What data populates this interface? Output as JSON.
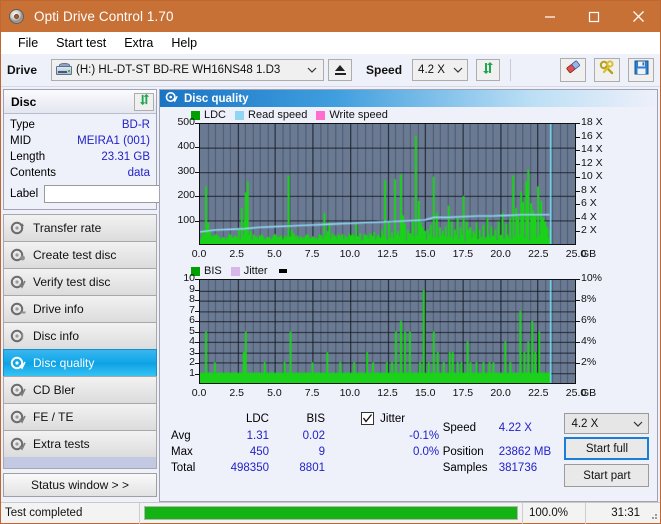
{
  "window": {
    "title": "Opti Drive Control 1.70",
    "title_icon": "disc-icon",
    "minimize": "–",
    "maximize": "□",
    "close": "✕"
  },
  "menu": {
    "items": [
      "File",
      "Start test",
      "Extra",
      "Help"
    ]
  },
  "toolbar": {
    "drive_label": "Drive",
    "drive_value": "(H:)   HL-DT-ST BD-RE  WH16NS48 1.D3",
    "eject_icon": "eject-icon",
    "speed_label": "Speed",
    "speed_value": "4.2 X",
    "refresh_icon": "refresh-icon",
    "eraser_icon": "eraser-icon",
    "tools_icon": "tools-icon",
    "save_icon": "save-icon"
  },
  "disc": {
    "header": "Disc",
    "refresh_icon": "refresh-disc-icon",
    "rows": [
      {
        "key": "Type",
        "value": "BD-R"
      },
      {
        "key": "MID",
        "value": "MEIRA1 (001)"
      },
      {
        "key": "Length",
        "value": "23.31 GB"
      },
      {
        "key": "Contents",
        "value": "data"
      }
    ],
    "label_key": "Label",
    "label_value": "",
    "label_placeholder": "",
    "label_button_icon": "disc-icon"
  },
  "nav": {
    "items": [
      {
        "label": "Transfer rate",
        "icon": "disc-test-icon",
        "selected": false
      },
      {
        "label": "Create test disc",
        "icon": "disc-burn-icon",
        "selected": false
      },
      {
        "label": "Verify test disc",
        "icon": "disc-verify-icon",
        "selected": false
      },
      {
        "label": "Drive info",
        "icon": "drive-info-icon",
        "selected": false
      },
      {
        "label": "Disc info",
        "icon": "disc-info-icon",
        "selected": false
      },
      {
        "label": "Disc quality",
        "icon": "disc-quality-icon",
        "selected": true
      },
      {
        "label": "CD Bler",
        "icon": "cd-bler-icon",
        "selected": false
      },
      {
        "label": "FE / TE",
        "icon": "fe-te-icon",
        "selected": false
      },
      {
        "label": "Extra tests",
        "icon": "extra-tests-icon",
        "selected": false
      }
    ],
    "status_window": "Status window > >"
  },
  "panel": {
    "title": "Disc quality",
    "icon": "disc-quality-icon"
  },
  "chart_data": [
    {
      "type": "line",
      "id": "ldc-chart",
      "title": "",
      "legend": [
        {
          "label": "LDC",
          "color": "#00a000"
        },
        {
          "label": "Read speed",
          "color": "#8fd6f5"
        },
        {
          "label": "Write speed",
          "color": "#ff6ecd"
        }
      ],
      "legend_position": "top-left",
      "xlabel": "GB",
      "x_ticks": [
        "0.0",
        "2.5",
        "5.0",
        "7.5",
        "10.0",
        "12.5",
        "15.0",
        "17.5",
        "20.0",
        "22.5",
        "25.0"
      ],
      "xlim": [
        0,
        25
      ],
      "ylabel": "LDC",
      "y_ticks": [
        "100",
        "200",
        "300",
        "400",
        "500"
      ],
      "ylim": [
        0,
        500
      ],
      "y2label": "Speed",
      "y2_ticks": [
        "2 X",
        "4 X",
        "6 X",
        "8 X",
        "10 X",
        "12 X",
        "14 X",
        "16 X",
        "18 X"
      ],
      "y2lim": [
        0,
        18
      ],
      "grid": true,
      "series": [
        {
          "name": "LDC",
          "color": "#19d219",
          "type": "bar",
          "x": [
            0.15,
            0.3,
            0.45,
            0.6,
            0.8,
            1.0,
            1.2,
            1.45,
            1.7,
            1.9,
            2.1,
            2.3,
            2.5,
            2.7,
            2.9,
            3.0,
            3.1,
            3.3,
            3.5,
            3.7,
            3.9,
            4.1,
            4.35,
            4.6,
            4.8,
            5.0,
            5.2,
            5.4,
            5.6,
            5.85,
            6.05,
            6.2,
            6.4,
            6.6,
            6.85,
            7.1,
            7.3,
            7.5,
            7.7,
            7.95,
            8.2,
            8.4,
            8.55,
            8.75,
            8.95,
            9.15,
            9.4,
            9.6,
            9.85,
            10.1,
            10.35,
            10.6,
            10.85,
            11.05,
            11.3,
            11.55,
            11.8,
            12.05,
            12.3,
            12.5,
            12.7,
            12.9,
            13.1,
            13.3,
            13.45,
            13.6,
            13.8,
            13.95,
            14.1,
            14.3,
            14.5,
            14.65,
            14.8,
            14.95,
            15.15,
            15.35,
            15.5,
            15.7,
            15.9,
            16.1,
            16.3,
            16.5,
            16.7,
            16.9,
            17.1,
            17.3,
            17.5,
            17.7,
            17.85,
            18.0,
            18.2,
            18.4,
            18.6,
            18.85,
            19.1,
            19.35,
            19.6,
            19.85,
            20.1,
            20.35,
            20.6,
            20.85,
            21.0,
            21.15,
            21.35,
            21.5,
            21.7,
            21.85,
            22.0,
            22.15,
            22.3,
            22.5,
            22.65,
            22.8,
            22.95,
            23.1,
            23.25
          ],
          "values": [
            60,
            240,
            90,
            55,
            35,
            25,
            30,
            20,
            25,
            20,
            25,
            30,
            60,
            150,
            100,
            215,
            260,
            55,
            40,
            30,
            35,
            30,
            25,
            30,
            25,
            40,
            30,
            25,
            35,
            285,
            60,
            45,
            35,
            30,
            25,
            30,
            25,
            30,
            25,
            35,
            130,
            55,
            90,
            45,
            35,
            30,
            40,
            35,
            45,
            40,
            85,
            45,
            40,
            35,
            45,
            50,
            40,
            60,
            265,
            95,
            50,
            270,
            55,
            290,
            120,
            85,
            60,
            45,
            95,
            450,
            180,
            90,
            70,
            55,
            60,
            80,
            280,
            130,
            70,
            55,
            75,
            160,
            95,
            60,
            110,
            70,
            200,
            95,
            60,
            70,
            55,
            90,
            60,
            80,
            110,
            75,
            60,
            95,
            130,
            85,
            110,
            285,
            150,
            115,
            220,
            175,
            260,
            310,
            170,
            140,
            120,
            240,
            180,
            110,
            95,
            70,
            60
          ]
        },
        {
          "name": "Read speed",
          "color": "#8fd6f5",
          "type": "line",
          "x": [
            0.0,
            1.0,
            2.0,
            3.0,
            4.0,
            5.0,
            6.0,
            7.0,
            8.0,
            9.0,
            10.0,
            11.0,
            12.0,
            13.0,
            14.0,
            15.0,
            15.6,
            16.5,
            17.5,
            18.5,
            19.5,
            20.5,
            21.5,
            22.5,
            23.3
          ],
          "values": [
            1.8,
            2.1,
            2.2,
            2.3,
            2.5,
            2.6,
            2.7,
            2.8,
            2.9,
            3.0,
            3.1,
            3.2,
            3.3,
            3.4,
            3.5,
            3.6,
            4.0,
            4.0,
            4.1,
            4.2,
            4.2,
            4.3,
            4.4,
            4.4,
            4.4
          ]
        }
      ],
      "cursor_x": 23.35,
      "cursor_color": "#6fe3ff"
    },
    {
      "type": "bar",
      "id": "bis-chart",
      "title": "",
      "legend": [
        {
          "label": "BIS",
          "color": "#00a000"
        },
        {
          "label": "Jitter",
          "color": "#d8b6e8"
        }
      ],
      "legend_position": "top-left",
      "xlabel": "GB",
      "x_ticks": [
        "0.0",
        "2.5",
        "5.0",
        "7.5",
        "10.0",
        "12.5",
        "15.0",
        "17.5",
        "20.0",
        "22.5",
        "25.0"
      ],
      "xlim": [
        0,
        25
      ],
      "ylabel": "BIS",
      "y_ticks": [
        "1",
        "2",
        "3",
        "4",
        "5",
        "6",
        "7",
        "8",
        "9",
        "10"
      ],
      "ylim": [
        0,
        10
      ],
      "y2label": "Jitter",
      "y2_ticks": [
        "2%",
        "4%",
        "6%",
        "8%",
        "10%"
      ],
      "y2lim": [
        0,
        10
      ],
      "grid": true,
      "series": [
        {
          "name": "BIS",
          "color": "#19d219",
          "type": "bar",
          "x": [
            0.3,
            0.55,
            0.9,
            1.3,
            1.8,
            2.3,
            2.85,
            3.0,
            3.5,
            3.9,
            4.25,
            4.7,
            5.2,
            5.6,
            6.0,
            6.5,
            7.0,
            7.4,
            7.9,
            8.4,
            8.8,
            9.3,
            9.7,
            10.2,
            10.6,
            11.1,
            11.5,
            11.9,
            12.4,
            12.7,
            13.0,
            13.35,
            13.6,
            13.9,
            14.2,
            14.6,
            14.85,
            15.2,
            15.55,
            15.8,
            16.2,
            16.55,
            16.8,
            17.1,
            17.4,
            17.75,
            18.0,
            18.4,
            18.8,
            19.2,
            19.5,
            19.9,
            20.3,
            20.6,
            21.0,
            21.3,
            21.55,
            21.8,
            22.05,
            22.3,
            22.55,
            22.8,
            23.1
          ],
          "values": [
            5,
            1,
            2,
            1,
            1,
            1,
            3,
            5,
            1,
            1,
            2,
            1,
            1,
            2,
            5,
            1,
            1,
            2,
            1,
            3,
            1,
            2,
            1,
            2,
            1,
            3,
            2,
            1,
            2,
            2,
            5,
            6,
            5,
            5,
            1,
            2,
            9,
            2,
            5,
            3,
            2,
            3,
            3,
            2,
            2,
            4,
            2,
            2,
            2,
            2,
            2,
            1,
            4,
            2,
            1,
            7,
            3,
            4,
            6,
            3,
            5,
            1,
            1
          ]
        },
        {
          "name": "Jitter",
          "color": "#d8b6e8",
          "type": "line",
          "x": [],
          "values": []
        }
      ],
      "baseline_band": {
        "from": 0.0,
        "to": 23.35,
        "value": 1,
        "color": "#19d219"
      },
      "cursor_x": 23.35,
      "cursor_color": "#6fe3ff"
    }
  ],
  "stats": {
    "columns": [
      "LDC",
      "BIS"
    ],
    "rows": [
      {
        "label": "Avg",
        "ldc": "1.31",
        "bis": "0.02",
        "jitter": "-0.1%"
      },
      {
        "label": "Max",
        "ldc": "450",
        "bis": "9",
        "jitter": "0.0%"
      },
      {
        "label": "Total",
        "ldc": "498350",
        "bis": "8801",
        "jitter": ""
      }
    ],
    "jitter_label": "Jitter",
    "jitter_checked": true,
    "info": [
      {
        "key": "Speed",
        "value": "4.22 X"
      },
      {
        "key": "Position",
        "value": "23862 MB"
      },
      {
        "key": "Samples",
        "value": "381736"
      }
    ],
    "speed_select": "4.2 X",
    "start_full": "Start full",
    "start_part": "Start part"
  },
  "statusbar": {
    "text": "Test completed",
    "progress_pct": 100.0,
    "progress_label": "100.0%",
    "elapsed": "31:31",
    "progress_color": "#12b312"
  }
}
